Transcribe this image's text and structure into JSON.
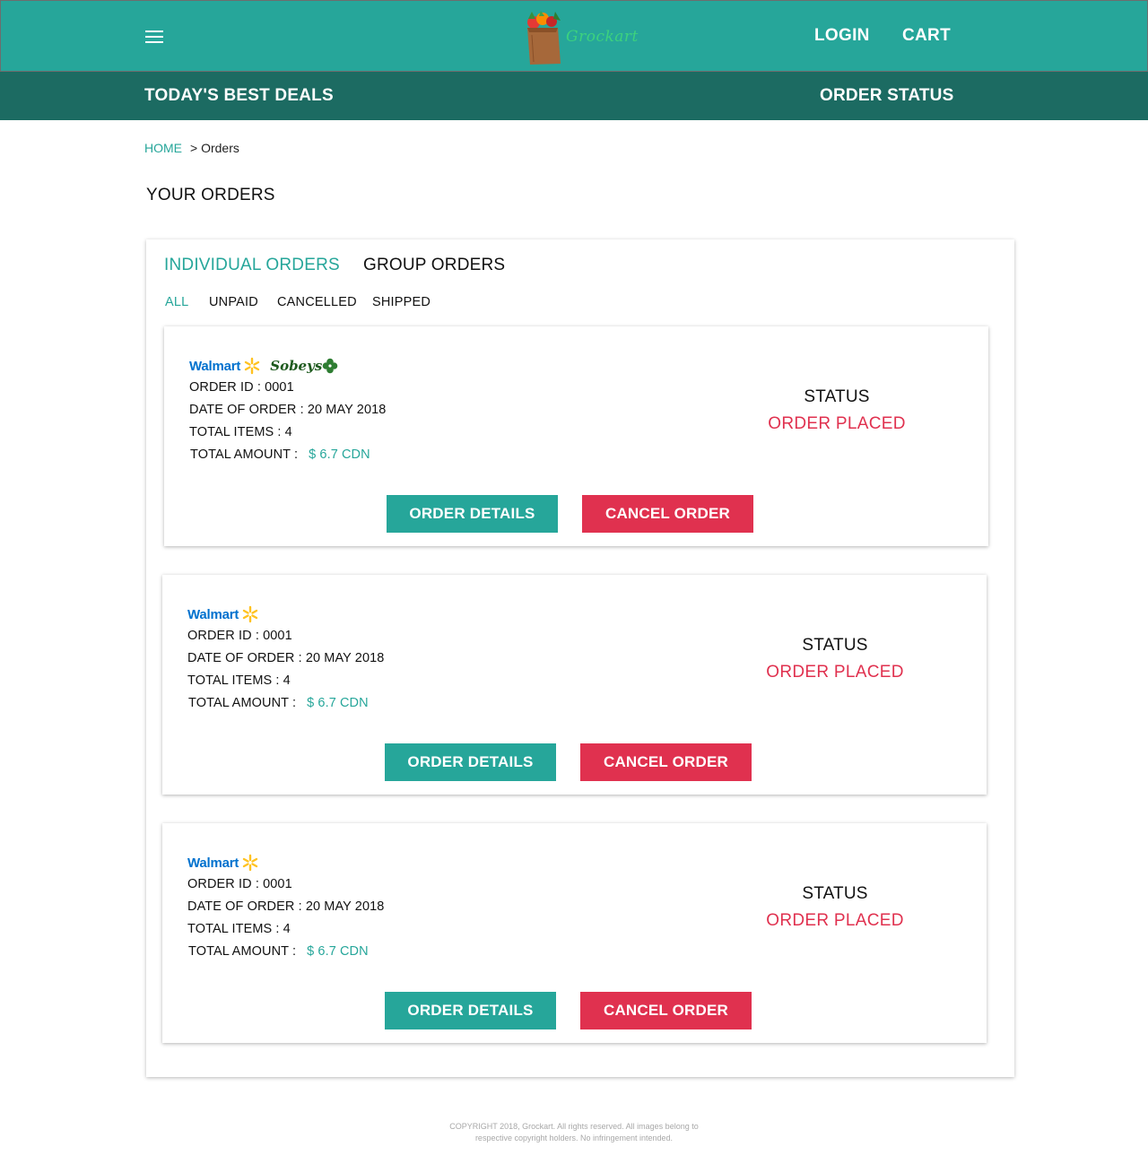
{
  "header": {
    "brand": "Grockart",
    "login_label": "LOGIN",
    "cart_label": "CART"
  },
  "subnav": {
    "deals_label": "TODAY'S BEST DEALS",
    "order_status_label": "ORDER STATUS"
  },
  "breadcrumb": {
    "home": "HOME",
    "current": "> Orders"
  },
  "page": {
    "title": "YOUR ORDERS"
  },
  "tabs": {
    "individual": "INDIVIDUAL ORDERS",
    "group": "GROUP ORDERS",
    "filters": [
      "ALL",
      "UNPAID",
      "CANCELLED",
      "SHIPPED"
    ],
    "active_filter": "ALL"
  },
  "orders": [
    {
      "stores": [
        "walmart",
        "sobeys"
      ],
      "walmart_text": "Walmart",
      "sobeys_text": "Sobeys",
      "order_id": "ORDER ID : 0001",
      "date": "DATE OF ORDER : 20 MAY 2018",
      "items": "TOTAL ITEMS : 4",
      "amount_label": "TOTAL AMOUNT :",
      "amount": "$ 6.7 CDN",
      "status_label": "STATUS",
      "status": "ORDER PLACED",
      "details_btn": "ORDER DETAILS",
      "cancel_btn": "CANCEL ORDER"
    },
    {
      "stores": [
        "walmart"
      ],
      "walmart_text": "Walmart",
      "order_id": "ORDER ID : 0001",
      "date": "DATE OF ORDER : 20 MAY 2018",
      "items": "TOTAL ITEMS : 4",
      "amount_label": "TOTAL AMOUNT :",
      "amount": "$ 6.7 CDN",
      "status_label": "STATUS",
      "status": "ORDER PLACED",
      "details_btn": "ORDER DETAILS",
      "cancel_btn": "CANCEL ORDER"
    },
    {
      "stores": [
        "walmart"
      ],
      "walmart_text": "Walmart",
      "order_id": "ORDER ID : 0001",
      "date": "DATE OF ORDER : 20 MAY 2018",
      "items": "TOTAL ITEMS : 4",
      "amount_label": "TOTAL AMOUNT :",
      "amount": "$ 6.7 CDN",
      "status_label": "STATUS",
      "status": "ORDER PLACED",
      "details_btn": "ORDER DETAILS",
      "cancel_btn": "CANCEL ORDER"
    }
  ],
  "footer": {
    "line1": "COPYRIGHT 2018, Grockart. All rights reserved. All images belong to",
    "line2": "respective copyright holders. No infringement intended."
  },
  "colors": {
    "primary": "#26a69a",
    "primary_dark": "#1c6b62",
    "danger": "#e0314f",
    "walmart_blue": "#0071ce",
    "walmart_yellow": "#ffc220",
    "sobeys_green": "#1e5a1e"
  },
  "icons": {
    "menu": "hamburger-menu-icon",
    "logo": "grocery-bag-icon",
    "walmart_spark": "walmart-spark-icon",
    "sobeys_clover": "sobeys-clover-icon"
  }
}
